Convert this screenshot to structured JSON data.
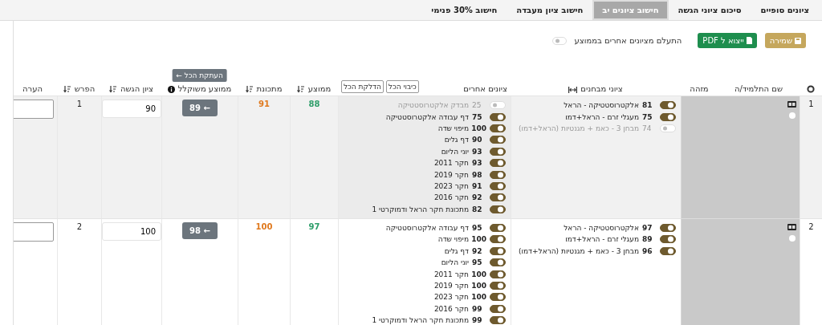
{
  "tabs": [
    {
      "label": "ציונים סופיים",
      "selected": false
    },
    {
      "label": "סיכום ציוני הגשה",
      "selected": false
    },
    {
      "label": "חישוב ציונים יב",
      "selected": true
    },
    {
      "label": "חישוב ציון מעבדה",
      "selected": false
    },
    {
      "label": "חישוב 30% פנימי",
      "selected": false
    }
  ],
  "toolbar": {
    "save_button": "שמירה",
    "pdf_button": "ייצוא ל PDF",
    "ignore_toggle": {
      "label": "התעלם מציונים אחרים בממוצע",
      "on": false
    }
  },
  "table": {
    "columns": [
      {
        "kind": "ring"
      },
      {
        "kind": "plain",
        "label": "שם התלמיד/ה"
      },
      {
        "kind": "plain",
        "label": "מזהה"
      },
      {
        "kind": "expand",
        "label": "ציוני מבחנים"
      },
      {
        "kind": "others",
        "label": "ציונים אחרים"
      },
      {
        "kind": "sort",
        "label": "ממוצע"
      },
      {
        "kind": "sort",
        "label": "מתכונת"
      },
      {
        "kind": "info",
        "label": "ממוצע משוקלל"
      },
      {
        "kind": "sort",
        "label": "ציון הגשה"
      },
      {
        "kind": "sort",
        "label": "הפרש"
      },
      {
        "kind": "plain",
        "label": "הערה"
      }
    ],
    "others_buttons": [
      "כיבוי הכל",
      "הדלקת הכל"
    ],
    "copy_all_button": "העתקת הכל ←",
    "rows": [
      {
        "index": "1",
        "highlighted": true,
        "radio_selected": false,
        "exams": [
          {
            "score": "81",
            "label": "אלקטרוסטטיקה - הראל",
            "on": true
          },
          {
            "score": "75",
            "label": "מעגלי זרם - הראל+דמו",
            "on": true
          },
          {
            "score": "74",
            "label": "מבחן 3 - כאמ + מגנטיות (הראל+דמו)",
            "on": false
          }
        ],
        "others": [
          {
            "score": "25",
            "label": "מבדק אלקטרוסטטיקה",
            "on": false
          },
          {
            "score": "75",
            "label": "דף עבודה אלקטרוסטטיקה",
            "on": true
          },
          {
            "score": "100",
            "label": "מיפוי שדה",
            "on": true
          },
          {
            "score": "90",
            "label": "דף גלים",
            "on": true
          },
          {
            "score": "93",
            "label": "יוני הליום",
            "on": true
          },
          {
            "score": "93",
            "label": "חקר 2011",
            "on": true
          },
          {
            "score": "98",
            "label": "חקר 2019",
            "on": true
          },
          {
            "score": "91",
            "label": "חקר 2023",
            "on": true
          },
          {
            "score": "92",
            "label": "חקר 2016",
            "on": true
          },
          {
            "score": "82",
            "label": "מתכונת חקר הראל ודמוקרטי 1",
            "on": true
          }
        ],
        "average": "88",
        "matkonet": "91",
        "weighted": "89 ←",
        "submission": "90",
        "difference": "1"
      },
      {
        "index": "2",
        "highlighted": false,
        "radio_selected": false,
        "exams": [
          {
            "score": "97",
            "label": "אלקטרוסטטיקה - הראל",
            "on": true
          },
          {
            "score": "89",
            "label": "מעגלי זרם - הראל+דמו",
            "on": true
          },
          {
            "score": "96",
            "label": "מבחן 3 - כאמ + מגנטיות (הראל+דמו)",
            "on": true
          }
        ],
        "others": [
          {
            "score": "95",
            "label": "דף עבודה אלקטרוסטטיקה",
            "on": true
          },
          {
            "score": "100",
            "label": "מיפוי שדה",
            "on": true
          },
          {
            "score": "92",
            "label": "דף גלים",
            "on": true
          },
          {
            "score": "95",
            "label": "יוני הליום",
            "on": true
          },
          {
            "score": "100",
            "label": "חקר 2011",
            "on": true
          },
          {
            "score": "100",
            "label": "חקר 2019",
            "on": true
          },
          {
            "score": "100",
            "label": "חקר 2023",
            "on": true
          },
          {
            "score": "99",
            "label": "חקר 2016",
            "on": true
          },
          {
            "score": "99",
            "label": "מתכונת חקר הראל ודמוקרטי 1",
            "on": true
          }
        ],
        "average": "97",
        "matkonet": "100",
        "weighted": "98 ←",
        "submission": "100",
        "difference": "2"
      }
    ]
  }
}
